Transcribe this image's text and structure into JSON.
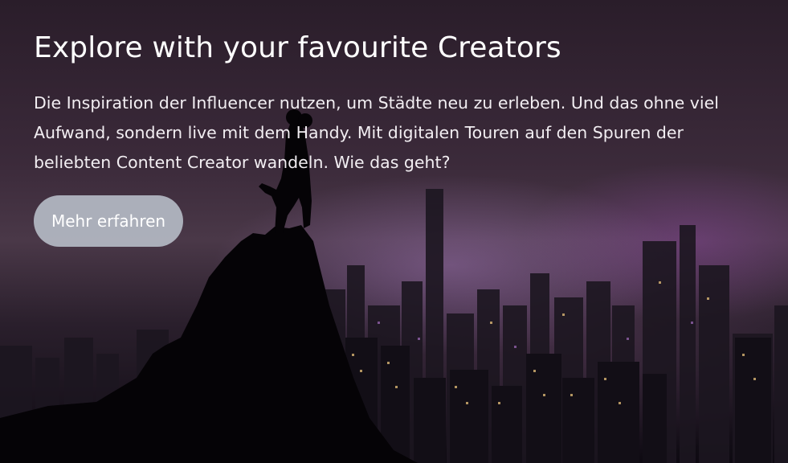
{
  "hero": {
    "title": "Explore with your favourite Creators",
    "description": "Die Inspiration der Influencer nutzen, um Städte neu zu erleben. Und das ohne viel Aufwand, sondern live mit dem Handy. Mit digitalen Touren auf den Spuren der beliebten Content Creator wandeln. Wie das geht?",
    "cta_label": "Mehr erfahren",
    "background_image": "night-city-skyline-couple-on-mountain-peak",
    "colors": {
      "cta_background": "#b4bac4",
      "text": "#ffffff"
    }
  }
}
